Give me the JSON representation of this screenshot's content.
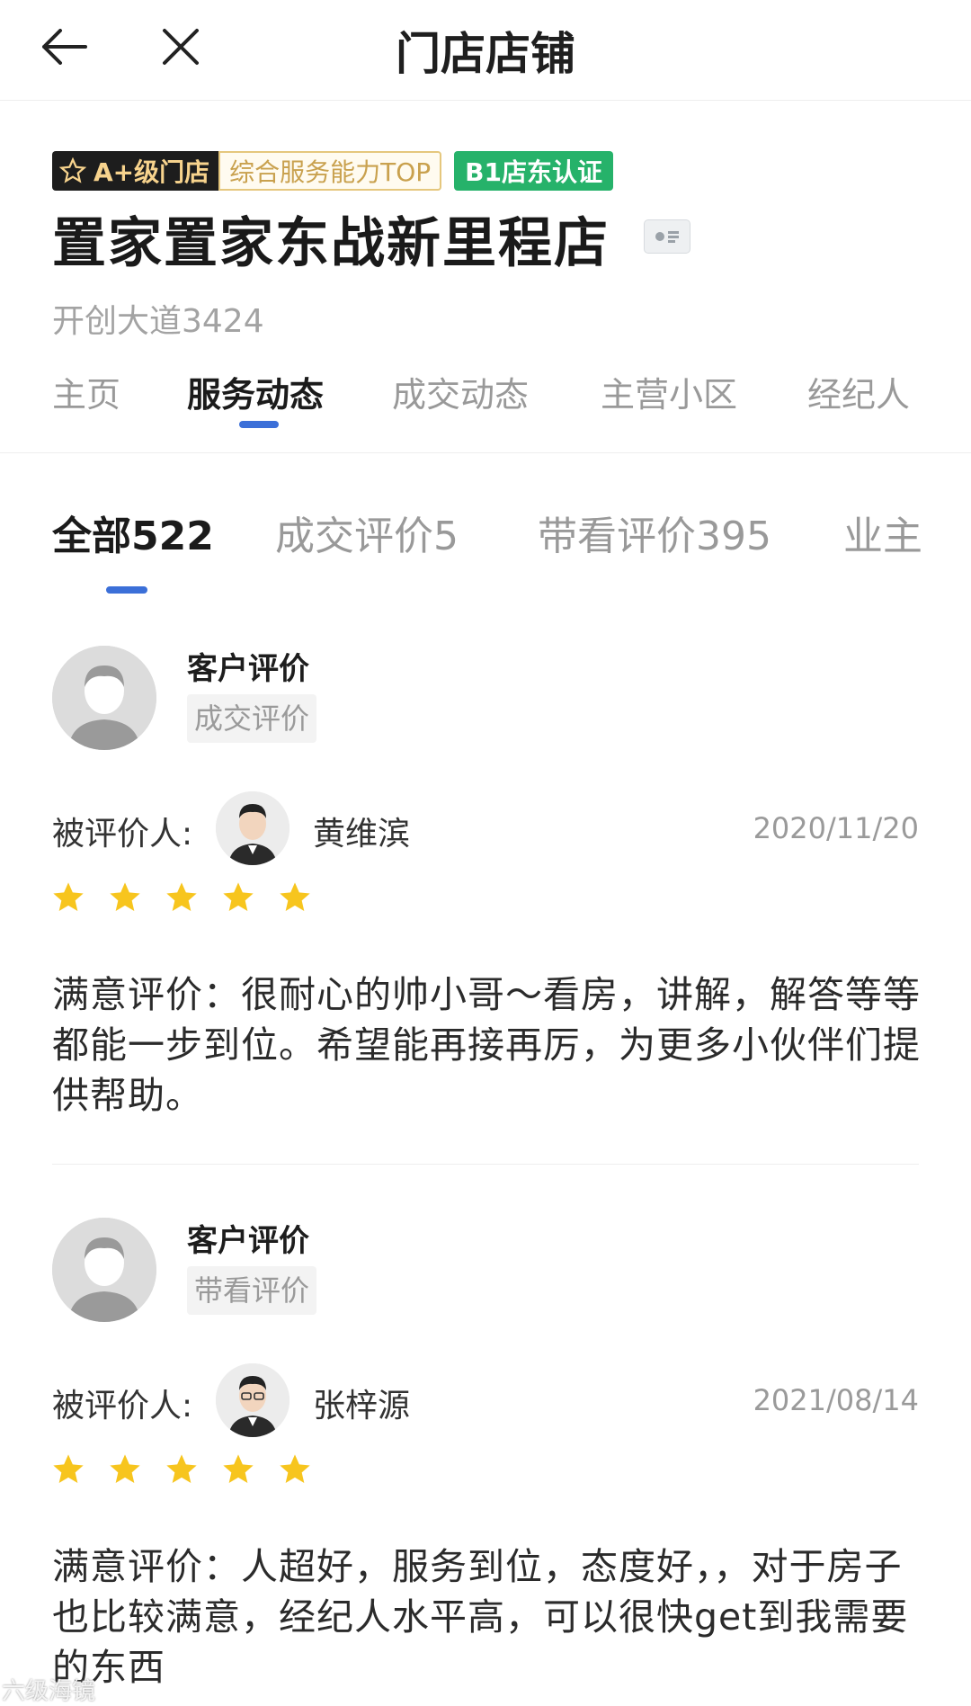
{
  "header": {
    "title": "门店店铺"
  },
  "store": {
    "badge_level": "A+级门店",
    "badge_service": "综合服务能力TOP",
    "badge_cert": "B1店东认证",
    "name": "置家置家东战新里程店",
    "address": "开创大道3424"
  },
  "main_tabs": [
    {
      "label": "主页"
    },
    {
      "label": "服务动态"
    },
    {
      "label": "成交动态"
    },
    {
      "label": "主营小区"
    },
    {
      "label": "经纪人"
    }
  ],
  "sub_tabs": [
    {
      "label": "全部522"
    },
    {
      "label": "成交评价5"
    },
    {
      "label": "带看评价395"
    },
    {
      "label": "业主"
    }
  ],
  "reviews": [
    {
      "title": "客户评价",
      "type": "成交评价",
      "reviewee_label": "被评价人:",
      "agent": "黄维滨",
      "date": "2020/11/20",
      "rating": 5,
      "text": "满意评价：很耐心的帅小哥～看房，讲解，解答等等都能一步到位。希望能再接再厉，为更多小伙伴们提供帮助。"
    },
    {
      "title": "客户评价",
      "type": "带看评价",
      "reviewee_label": "被评价人:",
      "agent": "张梓源",
      "date": "2021/08/14",
      "rating": 5,
      "text": "满意评价：人超好，服务到位，态度好，，对于房子也比较满意，经纪人水平高，可以很快get到我需要的东西"
    }
  ],
  "colors": {
    "accent": "#3b6fd8",
    "star": "#f7c51e",
    "badge_green": "#26b26a",
    "badge_gold": "#c9a14e"
  },
  "icons": {
    "back": "back-arrow-icon",
    "close": "close-icon",
    "star": "star-icon",
    "card": "business-card-icon"
  },
  "watermark": "六级海镜"
}
